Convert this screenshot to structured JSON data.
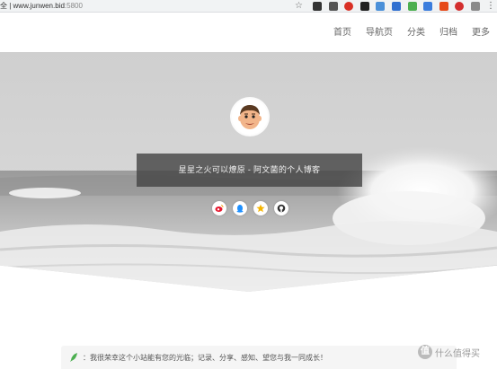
{
  "browser": {
    "url_prefix": "全 | ",
    "url_host": "www.junwen.bid",
    "url_port": ":5800",
    "extension_icons": [
      {
        "name": "ext-icon-1",
        "color": "#333333"
      },
      {
        "name": "ext-icon-2",
        "color": "#555555"
      },
      {
        "name": "ext-icon-3",
        "color": "#d93025"
      },
      {
        "name": "ext-icon-4",
        "color": "#222222"
      },
      {
        "name": "ext-icon-5",
        "color": "#4a90d9"
      },
      {
        "name": "ext-icon-6",
        "color": "#2f6fd0"
      },
      {
        "name": "ext-icon-7",
        "color": "#4caf50"
      },
      {
        "name": "ext-icon-8",
        "color": "#3b7ddd"
      },
      {
        "name": "ext-icon-9",
        "color": "#e64a19"
      },
      {
        "name": "ext-icon-10",
        "color": "#d32f2f"
      },
      {
        "name": "ext-icon-11",
        "color": "#8a8a8a"
      }
    ]
  },
  "nav": {
    "items": [
      "首页",
      "导航页",
      "分类",
      "归档",
      "更多"
    ]
  },
  "hero": {
    "tagline": "星星之火可以燎原 - 阿文菌的个人博客",
    "social_icons": [
      "weibo-icon",
      "qq-icon",
      "star-icon",
      "github-icon"
    ]
  },
  "notice": {
    "text": "：我很荣幸这个小站能有您的光临；记录、分享、感知、望您与我一同成长！"
  },
  "watermark": {
    "logo_char": "值",
    "text": "什么值得买"
  }
}
